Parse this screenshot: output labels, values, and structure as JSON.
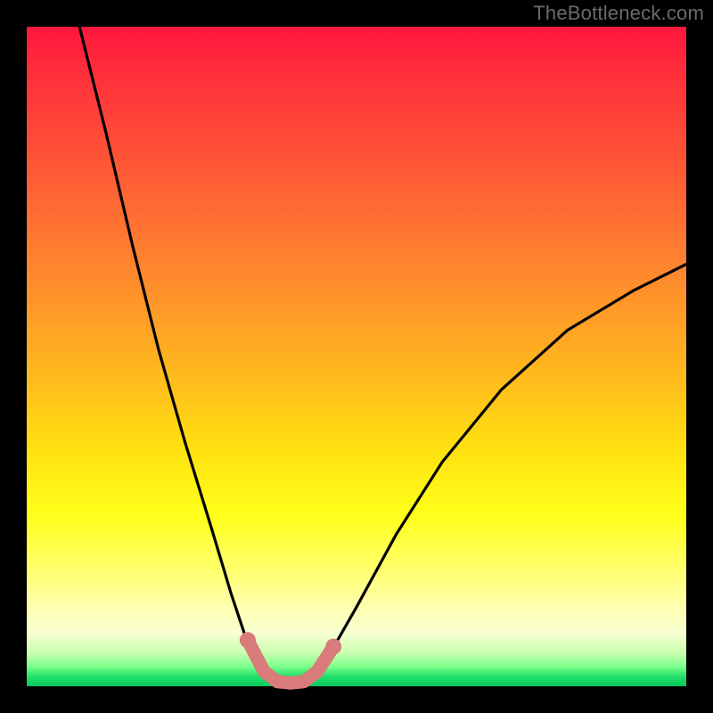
{
  "watermark": "TheBottleneck.com",
  "chart_data": {
    "type": "line",
    "title": "",
    "xlabel": "",
    "ylabel": "",
    "xlim": [
      0,
      100
    ],
    "ylim": [
      0,
      100
    ],
    "curve": {
      "left_branch": [
        {
          "x": 8,
          "y": 100
        },
        {
          "x": 12,
          "y": 84
        },
        {
          "x": 16,
          "y": 67
        },
        {
          "x": 20,
          "y": 51
        },
        {
          "x": 24,
          "y": 37
        },
        {
          "x": 28,
          "y": 24
        },
        {
          "x": 31,
          "y": 14
        },
        {
          "x": 33,
          "y": 8
        },
        {
          "x": 35,
          "y": 4
        },
        {
          "x": 37,
          "y": 1.5
        },
        {
          "x": 39,
          "y": 0.5
        }
      ],
      "right_branch": [
        {
          "x": 39,
          "y": 0.5
        },
        {
          "x": 41,
          "y": 0.5
        },
        {
          "x": 43,
          "y": 1.5
        },
        {
          "x": 46,
          "y": 5
        },
        {
          "x": 50,
          "y": 12
        },
        {
          "x": 56,
          "y": 23
        },
        {
          "x": 63,
          "y": 34
        },
        {
          "x": 72,
          "y": 45
        },
        {
          "x": 82,
          "y": 54
        },
        {
          "x": 92,
          "y": 60
        },
        {
          "x": 100,
          "y": 64
        }
      ]
    },
    "highlight": {
      "color": "#d97b7a",
      "points": [
        {
          "x": 33.5,
          "y": 7
        },
        {
          "x": 36,
          "y": 2.2
        },
        {
          "x": 38,
          "y": 0.7
        },
        {
          "x": 40,
          "y": 0.5
        },
        {
          "x": 42,
          "y": 0.7
        },
        {
          "x": 44,
          "y": 2.2
        },
        {
          "x": 46.5,
          "y": 6
        }
      ],
      "end_dots": [
        {
          "x": 33.5,
          "y": 7
        },
        {
          "x": 46.5,
          "y": 6
        }
      ]
    }
  }
}
